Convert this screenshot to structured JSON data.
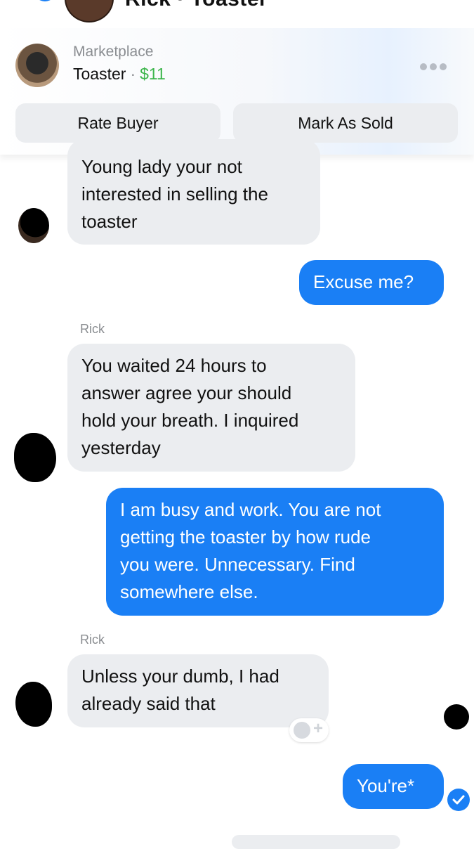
{
  "header": {
    "title": "Rick · Toaster"
  },
  "marketplace": {
    "label": "Marketplace",
    "item": "Toaster",
    "separator": "·",
    "price": "$11",
    "rate_buyer": "Rate Buyer",
    "mark_as_sold": "Mark As Sold"
  },
  "messages": [
    {
      "from": "Rick",
      "lines": [
        "Young lady your not",
        "interested in selling the",
        "toaster"
      ]
    },
    {
      "from": "me",
      "lines": [
        "Excuse me?"
      ]
    },
    {
      "sender_label": "Rick",
      "from": "Rick",
      "lines": [
        "You waited 24 hours to",
        "answer agree your should",
        "hold your breath. I inquired",
        "yesterday"
      ]
    },
    {
      "from": "me",
      "lines": [
        "I am busy and work. You are not",
        "getting the toaster by how rude",
        "you were. Unnecessary. Find",
        "somewhere else."
      ]
    },
    {
      "sender_label": "Rick",
      "from": "Rick",
      "lines": [
        "Unless your dumb, I had",
        "already said that"
      ]
    },
    {
      "from": "me",
      "lines": [
        "You're*"
      ]
    }
  ],
  "colors": {
    "accent": "#1a7ff5",
    "bubble_in": "#ebedf0",
    "price": "#3bb54a"
  }
}
